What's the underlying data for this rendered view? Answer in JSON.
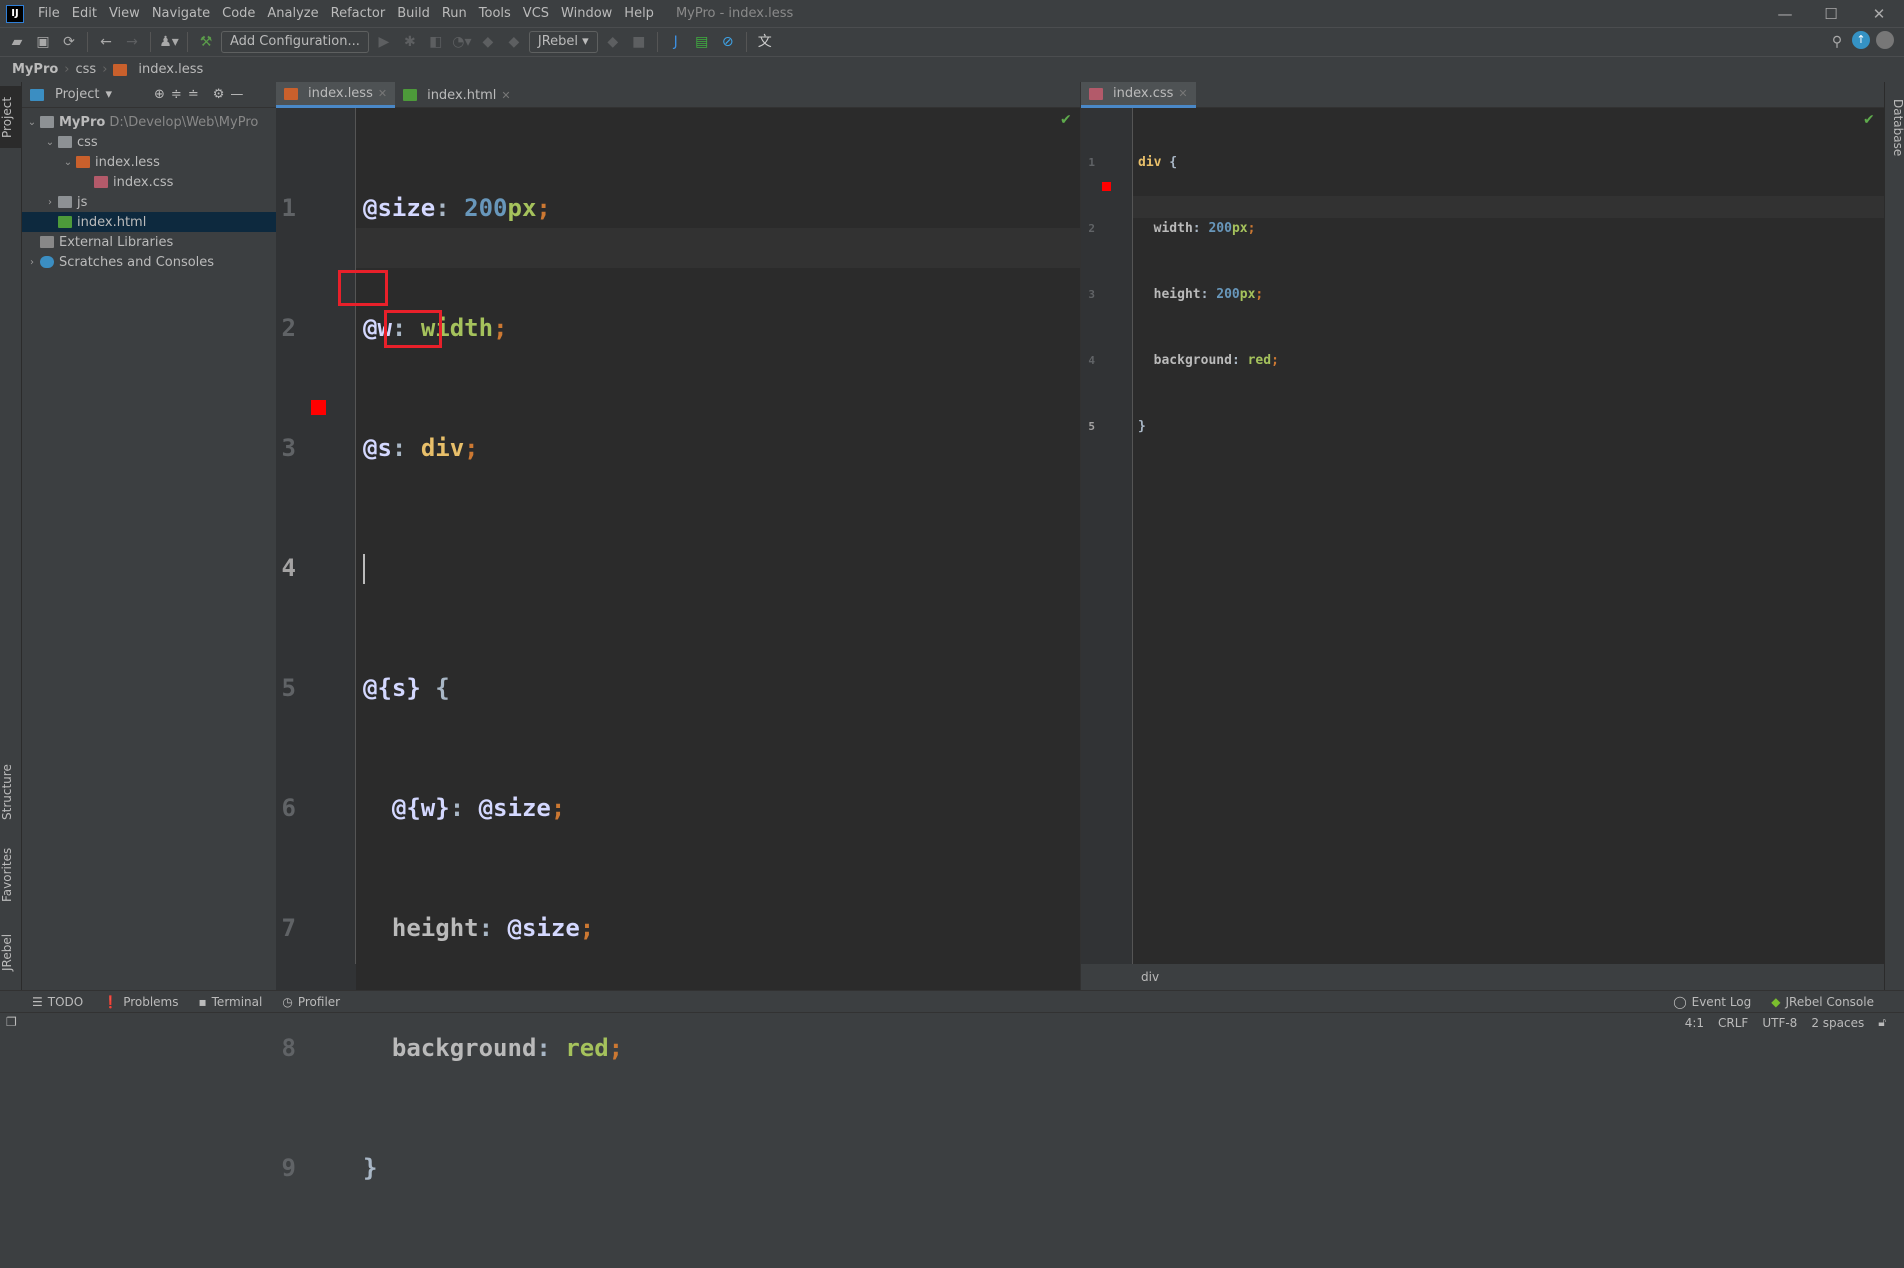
{
  "window": {
    "title": "MyPro - index.less",
    "app_logo": "IJ"
  },
  "menu": [
    "File",
    "Edit",
    "View",
    "Navigate",
    "Code",
    "Analyze",
    "Refactor",
    "Build",
    "Run",
    "Tools",
    "VCS",
    "Window",
    "Help"
  ],
  "toolbar": {
    "add_config": "Add Configuration...",
    "jrebel_combo": "JRebel"
  },
  "breadcrumb": [
    "MyPro",
    "css",
    "index.less"
  ],
  "left_stripe": {
    "project": "Project",
    "structure": "Structure",
    "favorites": "Favorites",
    "jrebel": "JRebel"
  },
  "right_stripe": {
    "database": "Database"
  },
  "project_panel": {
    "title": "Project",
    "tree": [
      {
        "label": "MyPro",
        "path": "D:\\Develop\\Web\\MyPro"
      },
      {
        "label": "css"
      },
      {
        "label": "index.less"
      },
      {
        "label": "index.css"
      },
      {
        "label": "js"
      },
      {
        "label": "index.html"
      },
      {
        "label": "External Libraries"
      },
      {
        "label": "Scratches and Consoles"
      }
    ]
  },
  "left_editor": {
    "tabs": [
      {
        "label": "index.less",
        "active": true
      },
      {
        "label": "index.html",
        "active": false
      }
    ],
    "line_numbers": [
      "1",
      "2",
      "3",
      "4",
      "5",
      "6",
      "7",
      "8",
      "9"
    ],
    "lines": {
      "l1": {
        "a": "@size",
        "b": ": ",
        "c": "200",
        "d": "px",
        ";": ";"
      },
      "l2": {
        "a": "@w",
        "b": ": ",
        "c": "width",
        ";": ";"
      },
      "l3": {
        "a": "@s",
        "b": ": ",
        "c": "div",
        ";": ";"
      },
      "l5": {
        "a": "@{s}",
        "b": " {"
      },
      "l6": {
        "a": "@{w}",
        "b": ": ",
        "c": "@size",
        ";": ";"
      },
      "l7": {
        "a": "height",
        "b": ": ",
        "c": "@size",
        ";": ";"
      },
      "l8": {
        "a": "background",
        "b": ": ",
        "c": "red",
        ";": ";"
      },
      "l9": {
        "a": "}"
      }
    },
    "color_swatch": "#ff0000"
  },
  "right_editor": {
    "tabs": [
      {
        "label": "index.css",
        "active": true
      }
    ],
    "line_numbers": [
      "1",
      "2",
      "3",
      "4",
      "5"
    ],
    "lines": {
      "l1": {
        "a": "div",
        "b": " {"
      },
      "l2": {
        "a": "width",
        "b": ": ",
        "c": "200",
        "d": "px",
        ";": ";"
      },
      "l3": {
        "a": "height",
        "b": ": ",
        "c": "200",
        "d": "px",
        ";": ";"
      },
      "l4": {
        "a": "background",
        "b": ": ",
        "c": "red",
        ";": ";"
      },
      "l5": {
        "a": "}"
      }
    },
    "breadcrumb": "div"
  },
  "tool_windows": [
    "TODO",
    "Problems",
    "Terminal",
    "Profiler"
  ],
  "tool_windows_right": [
    "Event Log",
    "JRebel Console"
  ],
  "status": {
    "position": "4:1",
    "line_sep": "CRLF",
    "encoding": "UTF-8",
    "indent": "2 spaces"
  }
}
